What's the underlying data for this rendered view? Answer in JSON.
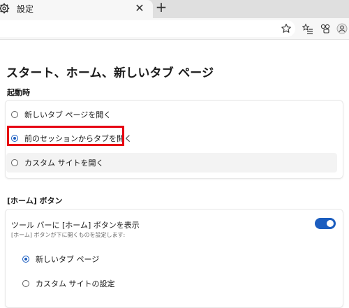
{
  "tab": {
    "title": "設定",
    "icon": "gear-icon",
    "close_label": "✕",
    "new_tab_label": "+"
  },
  "toolbar": {
    "icons": [
      "favorite-star-icon",
      "favorites-list-icon",
      "collections-icon",
      "profile-icon"
    ]
  },
  "page": {
    "title": "スタート、ホーム、新しいタブ ページ",
    "startup": {
      "heading": "起動時",
      "options": [
        {
          "label": "新しいタブ ページを開く",
          "selected": false
        },
        {
          "label": "前のセッションからタブを開く",
          "selected": true
        },
        {
          "label": "カスタム サイトを開く",
          "selected": false
        }
      ]
    },
    "home_button": {
      "heading": "[ホーム] ボタン",
      "toggle_label": "ツール バーに [ホーム] ボタンを表示",
      "toggle_description": "[ホーム] ボタンが下に開くものを設定します:",
      "toggle_on": true,
      "options": [
        {
          "label": "新しいタブ ページ",
          "selected": true
        },
        {
          "label": "カスタム サイトの設定",
          "selected": false
        }
      ]
    }
  },
  "colors": {
    "accent": "#1b5dbf",
    "highlight": "#e60012"
  }
}
